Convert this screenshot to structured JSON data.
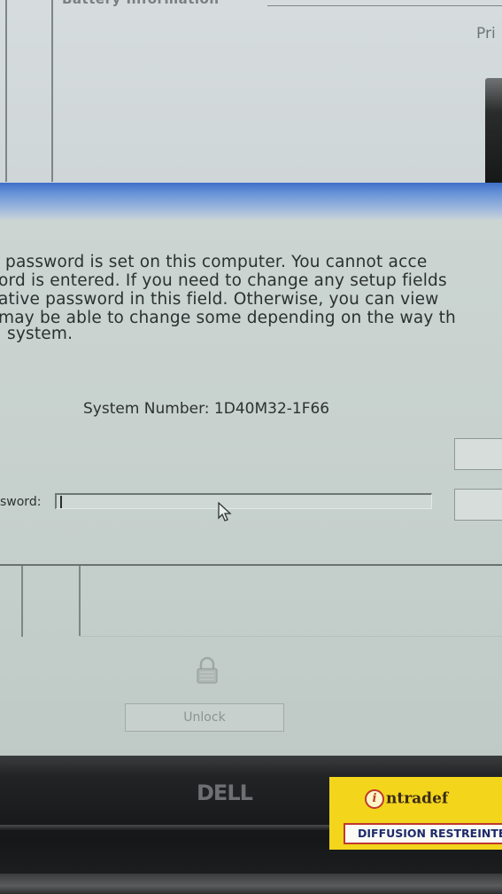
{
  "window": {
    "group_title": "Battery Information",
    "right_label": "Pri"
  },
  "dialog": {
    "message_lines": [
      "password is set on this computer.  You cannot acce",
      "ord is entered.  If you need to change any setup fields",
      "ative password in this field.  Otherwise, you can view",
      "may be able to change some depending on the way th",
      "system."
    ],
    "system_number": "System Number:  1D40M32-1F66",
    "password_label": "sword:",
    "password_value": "",
    "unlock_button": "Unlock"
  },
  "bezel": {
    "brand": "DELL",
    "sticker_brand": "ntradef",
    "sticker_band": "DIFFUSION RESTREINTE"
  },
  "colors": {
    "titlebar": "#3e6fc8",
    "dialog_bg": "#ccd5d2",
    "sticker_yellow": "#f3d61b",
    "sticker_red": "#c0392b"
  },
  "icons": [
    "lock-icon",
    "mouse-cursor-icon",
    "i-logo-icon"
  ]
}
